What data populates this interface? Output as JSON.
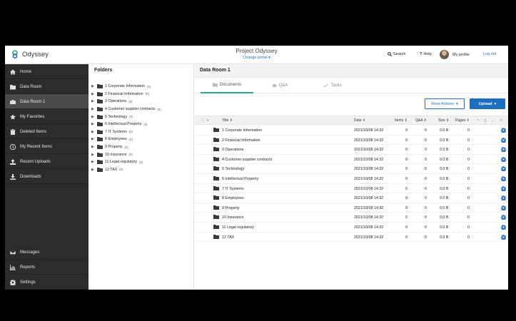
{
  "header": {
    "app_name": "Odyssey",
    "project_title": "Project Odyssey",
    "change_portal": "Change portal ▾",
    "search_label": "Search",
    "help_label": "Help",
    "profile_label": "My profile",
    "logout_label": "Log out"
  },
  "sidebar": {
    "items": [
      {
        "label": "Home",
        "icon": "home-icon"
      },
      {
        "label": "Data Room",
        "icon": "folder-icon"
      },
      {
        "label": "Data Room 1",
        "icon": "briefcase-icon",
        "active": true
      },
      {
        "label": "My Favorites",
        "icon": "star-icon"
      },
      {
        "label": "Deleted Items",
        "icon": "trash-icon"
      },
      {
        "label": "My Recent Items",
        "icon": "clock-icon"
      },
      {
        "label": "Recent Uploads",
        "icon": "upload-icon"
      },
      {
        "label": "Downloads",
        "icon": "download-icon"
      }
    ],
    "bottom_items": [
      {
        "label": "Messages",
        "icon": "envelope-icon"
      },
      {
        "label": "Reports",
        "icon": "bar-chart-icon"
      },
      {
        "label": "Settings",
        "icon": "gear-icon"
      }
    ]
  },
  "folders_panel": {
    "title": "Folders",
    "items": [
      {
        "name": "1 Corporate Information",
        "count": "(0)"
      },
      {
        "name": "2 Financial Information",
        "count": "(0)"
      },
      {
        "name": "3 Operations",
        "count": "(0)"
      },
      {
        "name": "4 Customer supplier contracts",
        "count": "(0)"
      },
      {
        "name": "5 Technology",
        "count": "(0)"
      },
      {
        "name": "6 Intellectual Property",
        "count": "(0)"
      },
      {
        "name": "7 IT Systems",
        "count": "(0)"
      },
      {
        "name": "8 Employees",
        "count": "(0)"
      },
      {
        "name": "9 Property",
        "count": "(0)"
      },
      {
        "name": "10 Insurance",
        "count": "(0)"
      },
      {
        "name": "11 Legal regulatory",
        "count": "(0)"
      },
      {
        "name": "12 TAX",
        "count": "(0)"
      }
    ]
  },
  "main": {
    "title": "Data Room 1",
    "tabs": [
      {
        "label": "Documents",
        "active": true
      },
      {
        "label": "Q&A"
      },
      {
        "label": "Tasks"
      }
    ],
    "more_actions_label": "More Actions",
    "upload_label": "Upload",
    "columns": {
      "title": "Title ⇕",
      "date": "Date ⇕",
      "items": "Items ⇕",
      "qa": "Q&A ⇕",
      "size": "Size ⇕",
      "pages": "Pages ⇕"
    },
    "rows": [
      {
        "title": "1 Corporate Information",
        "date": "2021/10/08 14:32",
        "items": "0",
        "qa": "0",
        "size": "0.0 B",
        "pages": "0"
      },
      {
        "title": "2 Financial Information",
        "date": "2021/10/08 14:32",
        "items": "0",
        "qa": "0",
        "size": "0.0 B",
        "pages": "0"
      },
      {
        "title": "3 Operations",
        "date": "2021/10/08 14:32",
        "items": "0",
        "qa": "0",
        "size": "0.0 B",
        "pages": "0"
      },
      {
        "title": "4 Customer supplier contracts",
        "date": "2021/10/08 14:32",
        "items": "0",
        "qa": "0",
        "size": "0.0 B",
        "pages": "0"
      },
      {
        "title": "5 Technology",
        "date": "2021/10/08 14:32",
        "items": "0",
        "qa": "0",
        "size": "0.0 B",
        "pages": "0"
      },
      {
        "title": "6 Intellectual Property",
        "date": "2021/10/08 14:32",
        "items": "0",
        "qa": "0",
        "size": "0.0 B",
        "pages": "0"
      },
      {
        "title": "7 IT Systems",
        "date": "2021/10/08 14:32",
        "items": "0",
        "qa": "0",
        "size": "0.0 B",
        "pages": "0"
      },
      {
        "title": "8 Employees",
        "date": "2021/10/08 14:32",
        "items": "0",
        "qa": "0",
        "size": "0.0 B",
        "pages": "0"
      },
      {
        "title": "9 Property",
        "date": "2021/10/08 14:32",
        "items": "0",
        "qa": "0",
        "size": "0.0 B",
        "pages": "0"
      },
      {
        "title": "10 Insurance",
        "date": "2021/10/08 14:32",
        "items": "0",
        "qa": "0",
        "size": "0.0 B",
        "pages": "0"
      },
      {
        "title": "11 Legal regulatory",
        "date": "2021/10/08 14:32",
        "items": "0",
        "qa": "0",
        "size": "0.0 B",
        "pages": "0"
      },
      {
        "title": "12 TAX",
        "date": "2021/10/08 14:32",
        "items": "0",
        "qa": "0",
        "size": "0.0 B",
        "pages": "0"
      }
    ]
  },
  "colors": {
    "sidebar_bg": "#2c2c2c",
    "sidebar_active": "#4b4b4b",
    "accent_blue": "#1e6fbf",
    "tab_underline": "#2fa88a"
  }
}
